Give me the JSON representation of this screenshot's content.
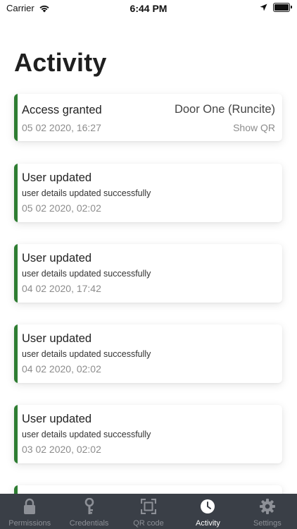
{
  "status_bar": {
    "carrier": "Carrier",
    "time": "6:44 PM"
  },
  "page": {
    "title": "Activity"
  },
  "colors": {
    "accent": "#2e7d32",
    "tab_bar_bg": "#3a3f47",
    "tab_inactive": "#8d9097",
    "tab_active": "#ffffff"
  },
  "activities": [
    {
      "title": "Access granted",
      "location": "Door One (Runcite)",
      "action": "Show QR",
      "time": "05 02 2020, 16:27"
    },
    {
      "title": "User updated",
      "detail": "user details updated successfully",
      "time": "05 02 2020, 02:02"
    },
    {
      "title": "User updated",
      "detail": "user details updated successfully",
      "time": "04 02 2020, 17:42"
    },
    {
      "title": "User updated",
      "detail": "user details updated successfully",
      "time": "04 02 2020, 02:02"
    },
    {
      "title": "User updated",
      "detail": "user details updated successfully",
      "time": "03 02 2020, 02:02"
    }
  ],
  "tabs": [
    {
      "label": "Permissions",
      "icon": "lock-icon",
      "active": false
    },
    {
      "label": "Credentials",
      "icon": "key-icon",
      "active": false
    },
    {
      "label": "QR code",
      "icon": "qr-scan-icon",
      "active": false
    },
    {
      "label": "Activity",
      "icon": "clock-icon",
      "active": true
    },
    {
      "label": "Settings",
      "icon": "gear-icon",
      "active": false
    }
  ]
}
